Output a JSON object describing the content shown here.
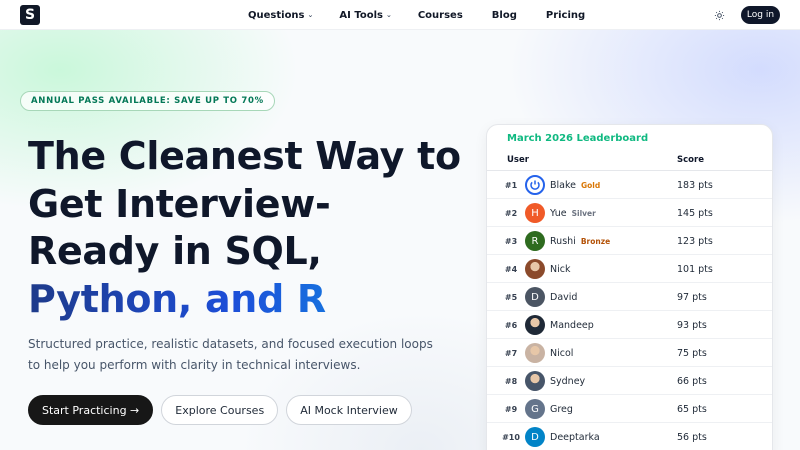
{
  "nav": {
    "logo_letter": "S",
    "links": [
      {
        "label": "Questions",
        "has_dropdown": true
      },
      {
        "label": "AI Tools",
        "has_dropdown": true
      },
      {
        "label": "Courses",
        "has_dropdown": false
      },
      {
        "label": "Blog",
        "has_dropdown": false
      },
      {
        "label": "Pricing",
        "has_dropdown": false
      }
    ],
    "theme_icon": "sun-icon",
    "dropdown_icon": "chevron-down-icon",
    "login_label": "Log in"
  },
  "hero": {
    "badge": "ANNUAL PASS AVAILABLE: SAVE UP TO 70%",
    "title_lines": [
      "The Cleanest Way to",
      "Get Interview-",
      "Ready in SQL,"
    ],
    "title_accent": "Python, and R",
    "subtitle": "Structured practice, realistic datasets, and focused execution loops to help you perform with clarity in technical interviews.",
    "cta_primary": "Start Practicing →",
    "cta_explore": "Explore Courses",
    "cta_mock": "AI Mock Interview"
  },
  "leaderboard": {
    "title": "March 2026 Leaderboard",
    "col_user": "User",
    "col_score": "Score",
    "rows": [
      {
        "rank": "#1",
        "name": "Blake",
        "medal": "Gold",
        "score": "183 pts",
        "initial": "",
        "avatar": "power-logo-avatar",
        "color": "#2563eb"
      },
      {
        "rank": "#2",
        "name": "Yue",
        "medal": "Silver",
        "score": "145 pts",
        "initial": "H",
        "avatar": "letter-avatar",
        "color": "#f05a28"
      },
      {
        "rank": "#3",
        "name": "Rushi",
        "medal": "Bronze",
        "score": "123 pts",
        "initial": "R",
        "avatar": "letter-avatar",
        "color": "#2e6b1f"
      },
      {
        "rank": "#4",
        "name": "Nick",
        "medal": "",
        "score": "101 pts",
        "initial": "",
        "avatar": "photo-avatar",
        "color": "#8b4a2b"
      },
      {
        "rank": "#5",
        "name": "David",
        "medal": "",
        "score": "97 pts",
        "initial": "D",
        "avatar": "letter-avatar",
        "color": "#4b5563"
      },
      {
        "rank": "#6",
        "name": "Mandeep",
        "medal": "",
        "score": "93 pts",
        "initial": "",
        "avatar": "photo-avatar",
        "color": "#1f2937"
      },
      {
        "rank": "#7",
        "name": "Nicol",
        "medal": "",
        "score": "75 pts",
        "initial": "",
        "avatar": "photo-avatar",
        "color": "#c9b3a3"
      },
      {
        "rank": "#8",
        "name": "Sydney",
        "medal": "",
        "score": "66 pts",
        "initial": "",
        "avatar": "photo-avatar",
        "color": "#475569"
      },
      {
        "rank": "#9",
        "name": "Greg",
        "medal": "",
        "score": "65 pts",
        "initial": "G",
        "avatar": "letter-avatar",
        "color": "#64748b"
      },
      {
        "rank": "#10",
        "name": "Deeptarka",
        "medal": "",
        "score": "56 pts",
        "initial": "D",
        "avatar": "letter-avatar",
        "color": "#0284c7"
      }
    ],
    "medal_colors": {
      "Gold": "#d97706",
      "Silver": "#6b7280",
      "Bronze": "#b45309"
    }
  }
}
